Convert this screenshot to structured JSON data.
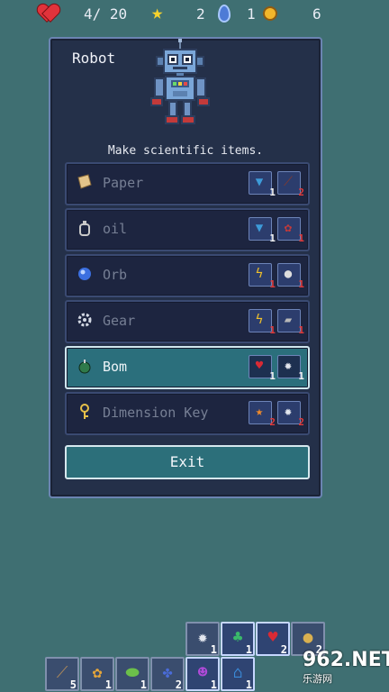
{
  "status": {
    "hearts": "4/ 20",
    "stars": "2",
    "gems": "1",
    "coins": "6"
  },
  "panel": {
    "title": "Robot",
    "subtitle": "Make scientific items.",
    "exit_label": "Exit",
    "recipes": [
      {
        "label": "Paper",
        "icon": "paper-icon",
        "ingredients": [
          {
            "icon": "cloth-icon",
            "count": "1",
            "color": "#3d9bd9"
          },
          {
            "icon": "branch-icon",
            "count": "2",
            "color": "#8a3a2a"
          }
        ]
      },
      {
        "label": "oil",
        "icon": "oil-bottle-icon",
        "ingredients": [
          {
            "icon": "cloth-icon",
            "count": "1",
            "color": "#3d9bd9"
          },
          {
            "icon": "berry-icon",
            "count": "1",
            "color": "#c33a3a"
          }
        ]
      },
      {
        "label": "Orb",
        "icon": "orb-icon",
        "ingredients": [
          {
            "icon": "lightning-icon",
            "count": "1",
            "color": "#f1c12a"
          },
          {
            "icon": "stone-icon",
            "count": "1",
            "color": "#dddddd"
          }
        ]
      },
      {
        "label": "Gear",
        "icon": "gear-icon",
        "ingredients": [
          {
            "icon": "lightning-icon",
            "count": "1",
            "color": "#f1c12a"
          },
          {
            "icon": "iron-bar-icon",
            "count": "1",
            "color": "#b8b8b8"
          }
        ]
      },
      {
        "label": "Bom",
        "icon": "bomb-icon",
        "selected": true,
        "ingredients": [
          {
            "icon": "heart-fruit-icon",
            "count": "1",
            "color": "#d92a34"
          },
          {
            "icon": "gear-icon",
            "count": "1",
            "color": "#e2e6ee"
          }
        ]
      },
      {
        "label": "Dimension Key",
        "icon": "key-icon",
        "ingredients": [
          {
            "icon": "star-icon",
            "count": "2",
            "color": "#f08a2a"
          },
          {
            "icon": "gear-icon",
            "count": "2",
            "color": "#e2e6ee"
          }
        ]
      }
    ]
  },
  "inventory": {
    "top_row": [
      {
        "icon": "gear-icon",
        "count": "1",
        "color": "#e2e6ee"
      },
      {
        "icon": "leaf-icon",
        "count": "1",
        "color": "#3ab86a"
      },
      {
        "icon": "heart-fruit-icon",
        "count": "2",
        "color": "#d92a34"
      },
      {
        "icon": "seed-icon",
        "count": "2",
        "color": "#d9b050"
      }
    ],
    "bottom_row": [
      {
        "icon": "feather-icon",
        "count": "5",
        "color": "#b08a5a"
      },
      {
        "icon": "flower-icon",
        "count": "1",
        "color": "#e4a53a"
      },
      {
        "icon": "slime-icon",
        "count": "1",
        "color": "#6cc04a"
      },
      {
        "icon": "berries-icon",
        "count": "2",
        "color": "#4a6cd9"
      },
      {
        "icon": "skull-gem-icon",
        "count": "1",
        "color": "#b04ad9"
      },
      {
        "icon": "bottle-icon",
        "count": "1",
        "color": "#3a8ad9"
      }
    ]
  },
  "watermark": {
    "text": "962.NET",
    "sub": "乐游网"
  }
}
